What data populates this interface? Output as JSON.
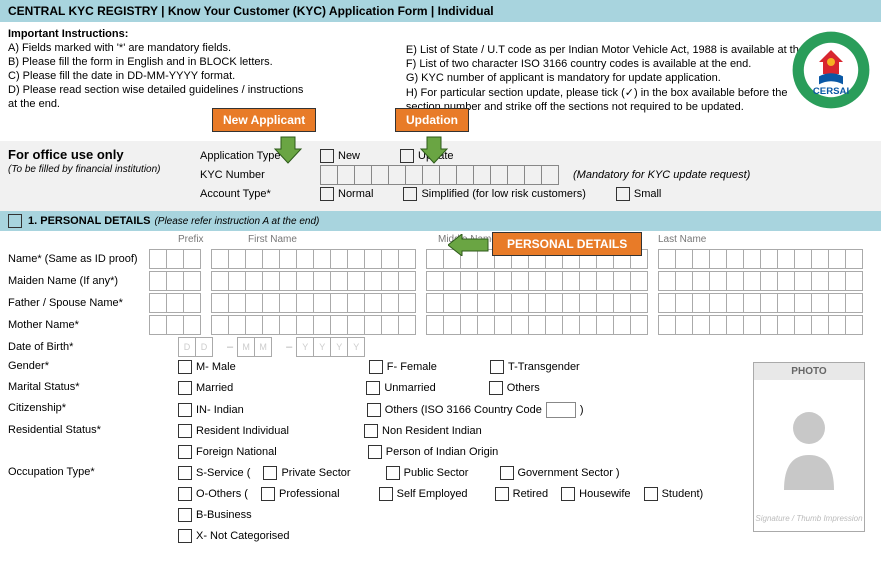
{
  "header": "CENTRAL KYC REGISTRY  | Know Your Customer (KYC) Application Form | Individual",
  "instr_title": "Important Instructions:",
  "instr_left": [
    "A) Fields marked with '*' are mandatory fields.",
    "B) Please fill the form in English and in BLOCK letters.",
    "C) Please fill the date in DD-MM-YYYY format.",
    "D) Please read section wise detailed guidelines / instructions",
    "     at the end."
  ],
  "instr_right": [
    "E)  List of State / U.T code as per Indian Motor Vehicle Act, 1988 is available at the end.",
    "F)  List of two character ISO 3166 country codes is available at the end.",
    "G) KYC number of applicant is mandatory for update application.",
    "H) For particular section update, please tick (✓) in the box available before the",
    "     section number and strike off the sections not required to be updated."
  ],
  "callouts": {
    "new": "New Applicant",
    "upd": "Updation",
    "pd": "PERSONAL DETAILS"
  },
  "office": {
    "title": "For office use only",
    "sub": "(To be filled by financial institution)",
    "app_type": "Application Type*",
    "new": "New",
    "update": "Update",
    "kyc": "KYC Number",
    "mand": "(Mandatory for KYC update request)",
    "acct": "Account  Type*",
    "normal": "Normal",
    "simplified": "Simplified (for low risk customers)",
    "small": "Small"
  },
  "sec1": {
    "num": "1.  PERSONAL DETAILS",
    "sub": "(Please refer instruction A at the end)"
  },
  "cols": {
    "prefix": "Prefix",
    "first": "First Name",
    "middle": "Middle Name",
    "last": "Last Name"
  },
  "rows": {
    "name": "Name* (Same as ID proof)",
    "maiden": "Maiden Name (If any*)",
    "father": "Father / Spouse Name*",
    "mother": "Mother Name*",
    "dob": "Date of Birth*",
    "gender": "Gender*",
    "marital": "Marital Status*",
    "citizen": "Citizenship*",
    "res": "Residential Status*",
    "occ": "Occupation Type*"
  },
  "dob_ph": [
    "D",
    "D",
    "M",
    "M",
    "Y",
    "Y",
    "Y",
    "Y"
  ],
  "gender": {
    "m": "M- Male",
    "f": "F- Female",
    "t": "T-Transgender"
  },
  "marital": {
    "m": "Married",
    "u": "Unmarried",
    "o": "Others"
  },
  "citizen": {
    "in": "IN- Indian",
    "oth_pre": "Others  (ISO 3166 Country Code",
    "oth_post": ")"
  },
  "res": {
    "a": "Resident Individual",
    "b": "Non Resident Indian",
    "c": "Foreign National",
    "d": "Person of Indian Origin"
  },
  "occ": {
    "s": "S-Service  (",
    "priv": "Private Sector",
    "pub": "Public Sector",
    "gov": "Government Sector )",
    "o": "O-Others  (",
    "prof": "Professional",
    "self": "Self Employed",
    "ret": "Retired",
    "hw": "Housewife",
    "stu": "Student)",
    "b": "B-Business",
    "x": "X- Not Categorised"
  },
  "photo": {
    "title": "PHOTO",
    "sig": "Signature / Thumb Impression"
  }
}
